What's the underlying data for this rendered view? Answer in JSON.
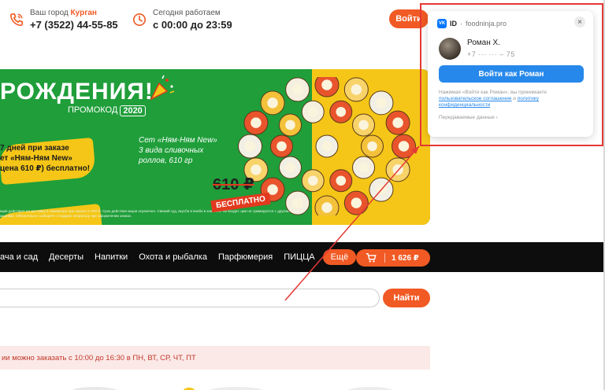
{
  "header": {
    "city_prefix": "Ваш город",
    "city": "Курган",
    "phone": "+7 (3522) 44-55-85",
    "hours_label": "Сегодня работаем",
    "hours": "с 00:00 до 23:59",
    "login_label": "Войти"
  },
  "banner": {
    "title": "РОЖДЕНИЯ!",
    "promo_label": "ПРОМОКОД",
    "promo_code": "2020",
    "offer_line1": "7 дней при заказе",
    "offer_line2": "ет «Ням-Ням New»",
    "offer_line3": "цена 610 ₽) бесплатно!",
    "set_line1": "Сет «Ням-Ням New»",
    "set_line2": "3 вида сливочных",
    "set_line3": "роллов, 610 гр",
    "old_price": "610 ₽",
    "free_label": "БЕСПЛАТНО",
    "small_print": "кция действует на доставку и самовывоз при заказе от 970 ₽. Срок действия акции ограничен. Свежий суд, вкусби в вниби в комплект не входит. ции не суммируется с другими акциями. Обязательно сообщите о подарке оператору при оформлении заказа."
  },
  "nav": {
    "items": [
      "ача и сад",
      "Десерты",
      "Напитки",
      "Охота и рыбалка",
      "Парфюмерия",
      "ПИЦЦА"
    ],
    "more_label": "Ещё"
  },
  "cart": {
    "total": "1 626 ₽"
  },
  "search": {
    "value": "",
    "button_label": "Найти"
  },
  "notice": {
    "text": "ии можно заказать с 10:00 до 16:30 в ПН, ВТ, СР, ЧТ, ПТ"
  },
  "vk_popup": {
    "logo_text": "VK",
    "id_label": "ID",
    "separator": "·",
    "site": "foodninja.pro",
    "close_glyph": "×",
    "user_name": "Роман Х.",
    "user_phone": "+7 ··· ··· – 75",
    "signin_label": "Войти как Роман",
    "legal_prefix": "Нажимая «Войти как Роман», вы принимаете",
    "legal_link1": "пользовательское соглашение",
    "legal_and": "и",
    "legal_link2": "политику конфиденциальности",
    "transfer_label": "Передаваемые данные ›"
  },
  "colors": {
    "accent": "#f15a24",
    "banner_green": "#1f9e3a",
    "banner_yellow": "#f5c617",
    "vk_blue": "#2688eb",
    "annotation_red": "#e53935"
  }
}
